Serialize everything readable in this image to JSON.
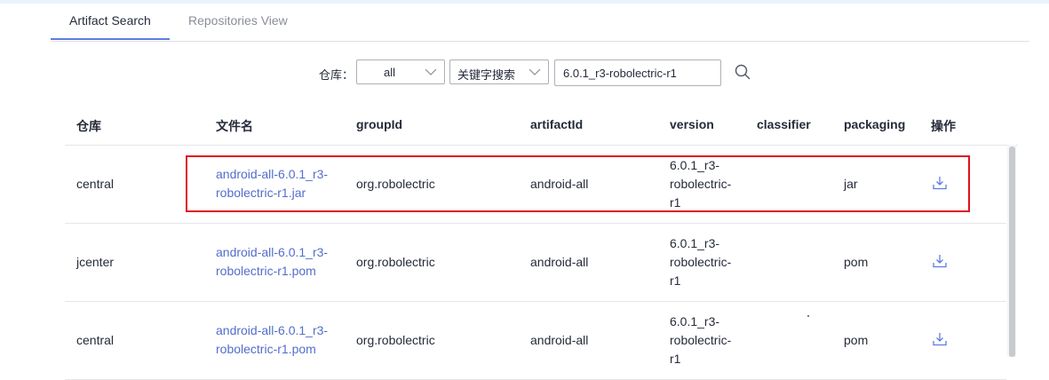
{
  "tabs": [
    {
      "label": "Artifact Search",
      "active": true
    },
    {
      "label": "Repositories View",
      "active": false
    }
  ],
  "search": {
    "repo_label": "仓库：",
    "repo_value": "all",
    "type_value": "关键字搜索",
    "query_value": "6.0.1_r3-robolectric-r1",
    "search_icon": "search-icon"
  },
  "table": {
    "columns": [
      "仓库",
      "文件名",
      "groupId",
      "artifactId",
      "version",
      "classifier",
      "packaging",
      "操作"
    ],
    "rows": [
      {
        "repo": "central",
        "file_line1": "android-all-6.0.1_r3-",
        "file_line2": "robolectric-r1.jar",
        "group": "org.robolectric",
        "artifact": "android-all",
        "ver1": "6.0.1_r3-",
        "ver2": "robolectric-",
        "ver3": "r1",
        "classifier": "",
        "packaging": "jar",
        "action_icon": "download-icon"
      },
      {
        "repo": "jcenter",
        "file_line1": "android-all-6.0.1_r3-",
        "file_line2": "robolectric-r1.pom",
        "group": "org.robolectric",
        "artifact": "android-all",
        "ver1": "6.0.1_r3-",
        "ver2": "robolectric-",
        "ver3": "r1",
        "classifier": "",
        "packaging": "pom",
        "action_icon": "download-icon"
      },
      {
        "repo": "central",
        "file_line1": "android-all-6.0.1_r3-",
        "file_line2": "robolectric-r1.pom",
        "group": "org.robolectric",
        "artifact": "android-all",
        "ver1": "6.0.1_r3-",
        "ver2": "robolectric-",
        "ver3": "r1",
        "classifier": "",
        "packaging": "pom",
        "action_icon": "download-icon"
      }
    ]
  },
  "colors": {
    "accent": "#5e7ce0",
    "link": "#526ecc",
    "highlight_box": "#e0121b"
  }
}
